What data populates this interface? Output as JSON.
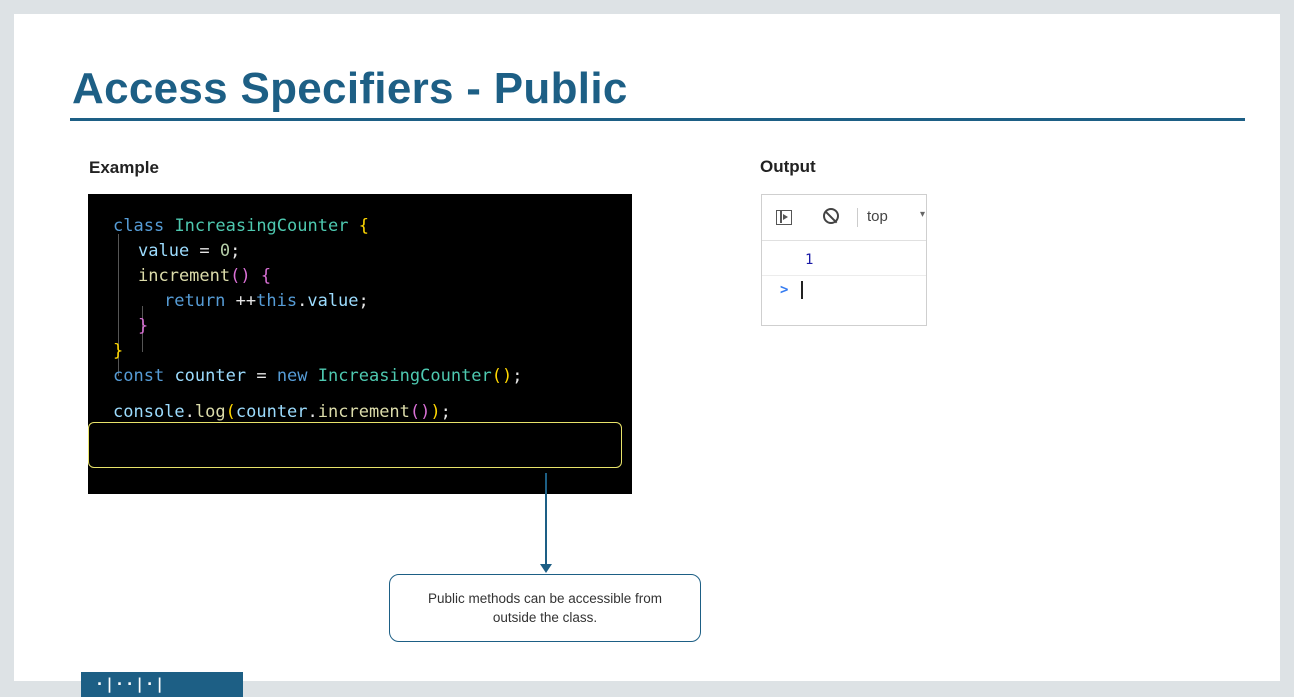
{
  "slide": {
    "title": "Access Specifiers - Public",
    "example_label": "Example",
    "output_label": "Output"
  },
  "code": {
    "lines": [
      "class IncreasingCounter {",
      "value = 0;",
      "increment() {",
      "return ++this.value;",
      "}",
      "}",
      "const counter = new IncreasingCounter();",
      "console.log(counter.increment());"
    ]
  },
  "callout": {
    "text": "Public methods can be accessible from outside the class."
  },
  "console": {
    "context": "top",
    "output_value": "1",
    "prompt": ">"
  },
  "footer": {
    "tab_text": "·|··|·|"
  },
  "colors": {
    "accent": "#1d5f85",
    "highlight_border": "#e8e36a",
    "code_background": "#000000"
  }
}
